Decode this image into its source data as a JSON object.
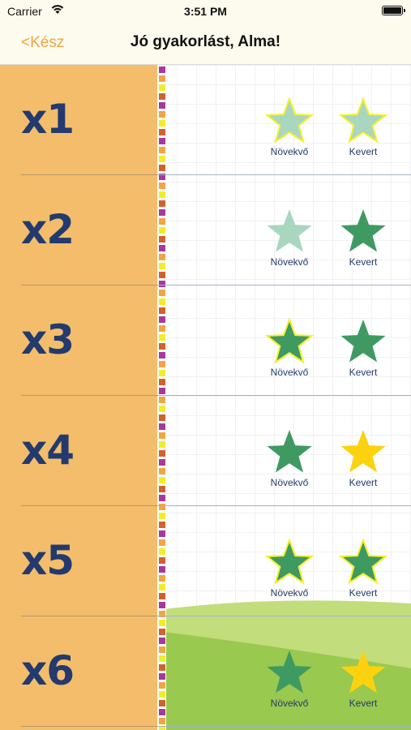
{
  "status_bar": {
    "carrier": "Carrier",
    "time": "3:51 PM"
  },
  "nav": {
    "back_label": "<Kész",
    "title": "Jó gyakorlást, Alma!"
  },
  "colors": {
    "accent": "#f2a541",
    "left_panel": "#f3bd6c",
    "multiplier_text": "#233a6e",
    "star_dark": "#3f9a62",
    "star_light": "#a9d6bf",
    "star_gold": "#fcd20e",
    "star_outline": "#f4f12a"
  },
  "rows": [
    {
      "multiplier": "x1",
      "ascending": {
        "label": "Növekvő",
        "state": "light-outlined"
      },
      "mixed": {
        "label": "Kevert",
        "state": "light-outlined"
      }
    },
    {
      "multiplier": "x2",
      "ascending": {
        "label": "Növekvő",
        "state": "light"
      },
      "mixed": {
        "label": "Kevert",
        "state": "dark"
      }
    },
    {
      "multiplier": "x3",
      "ascending": {
        "label": "Növekvő",
        "state": "dark-outlined"
      },
      "mixed": {
        "label": "Kevert",
        "state": "dark"
      }
    },
    {
      "multiplier": "x4",
      "ascending": {
        "label": "Növekvő",
        "state": "dark"
      },
      "mixed": {
        "label": "Kevert",
        "state": "gold"
      }
    },
    {
      "multiplier": "x5",
      "ascending": {
        "label": "Növekvő",
        "state": "dark-outlined"
      },
      "mixed": {
        "label": "Kevert",
        "state": "dark-outlined"
      }
    },
    {
      "multiplier": "x6",
      "ascending": {
        "label": "Növekvő",
        "state": "dark"
      },
      "mixed": {
        "label": "Kevert",
        "state": "gold"
      }
    }
  ]
}
